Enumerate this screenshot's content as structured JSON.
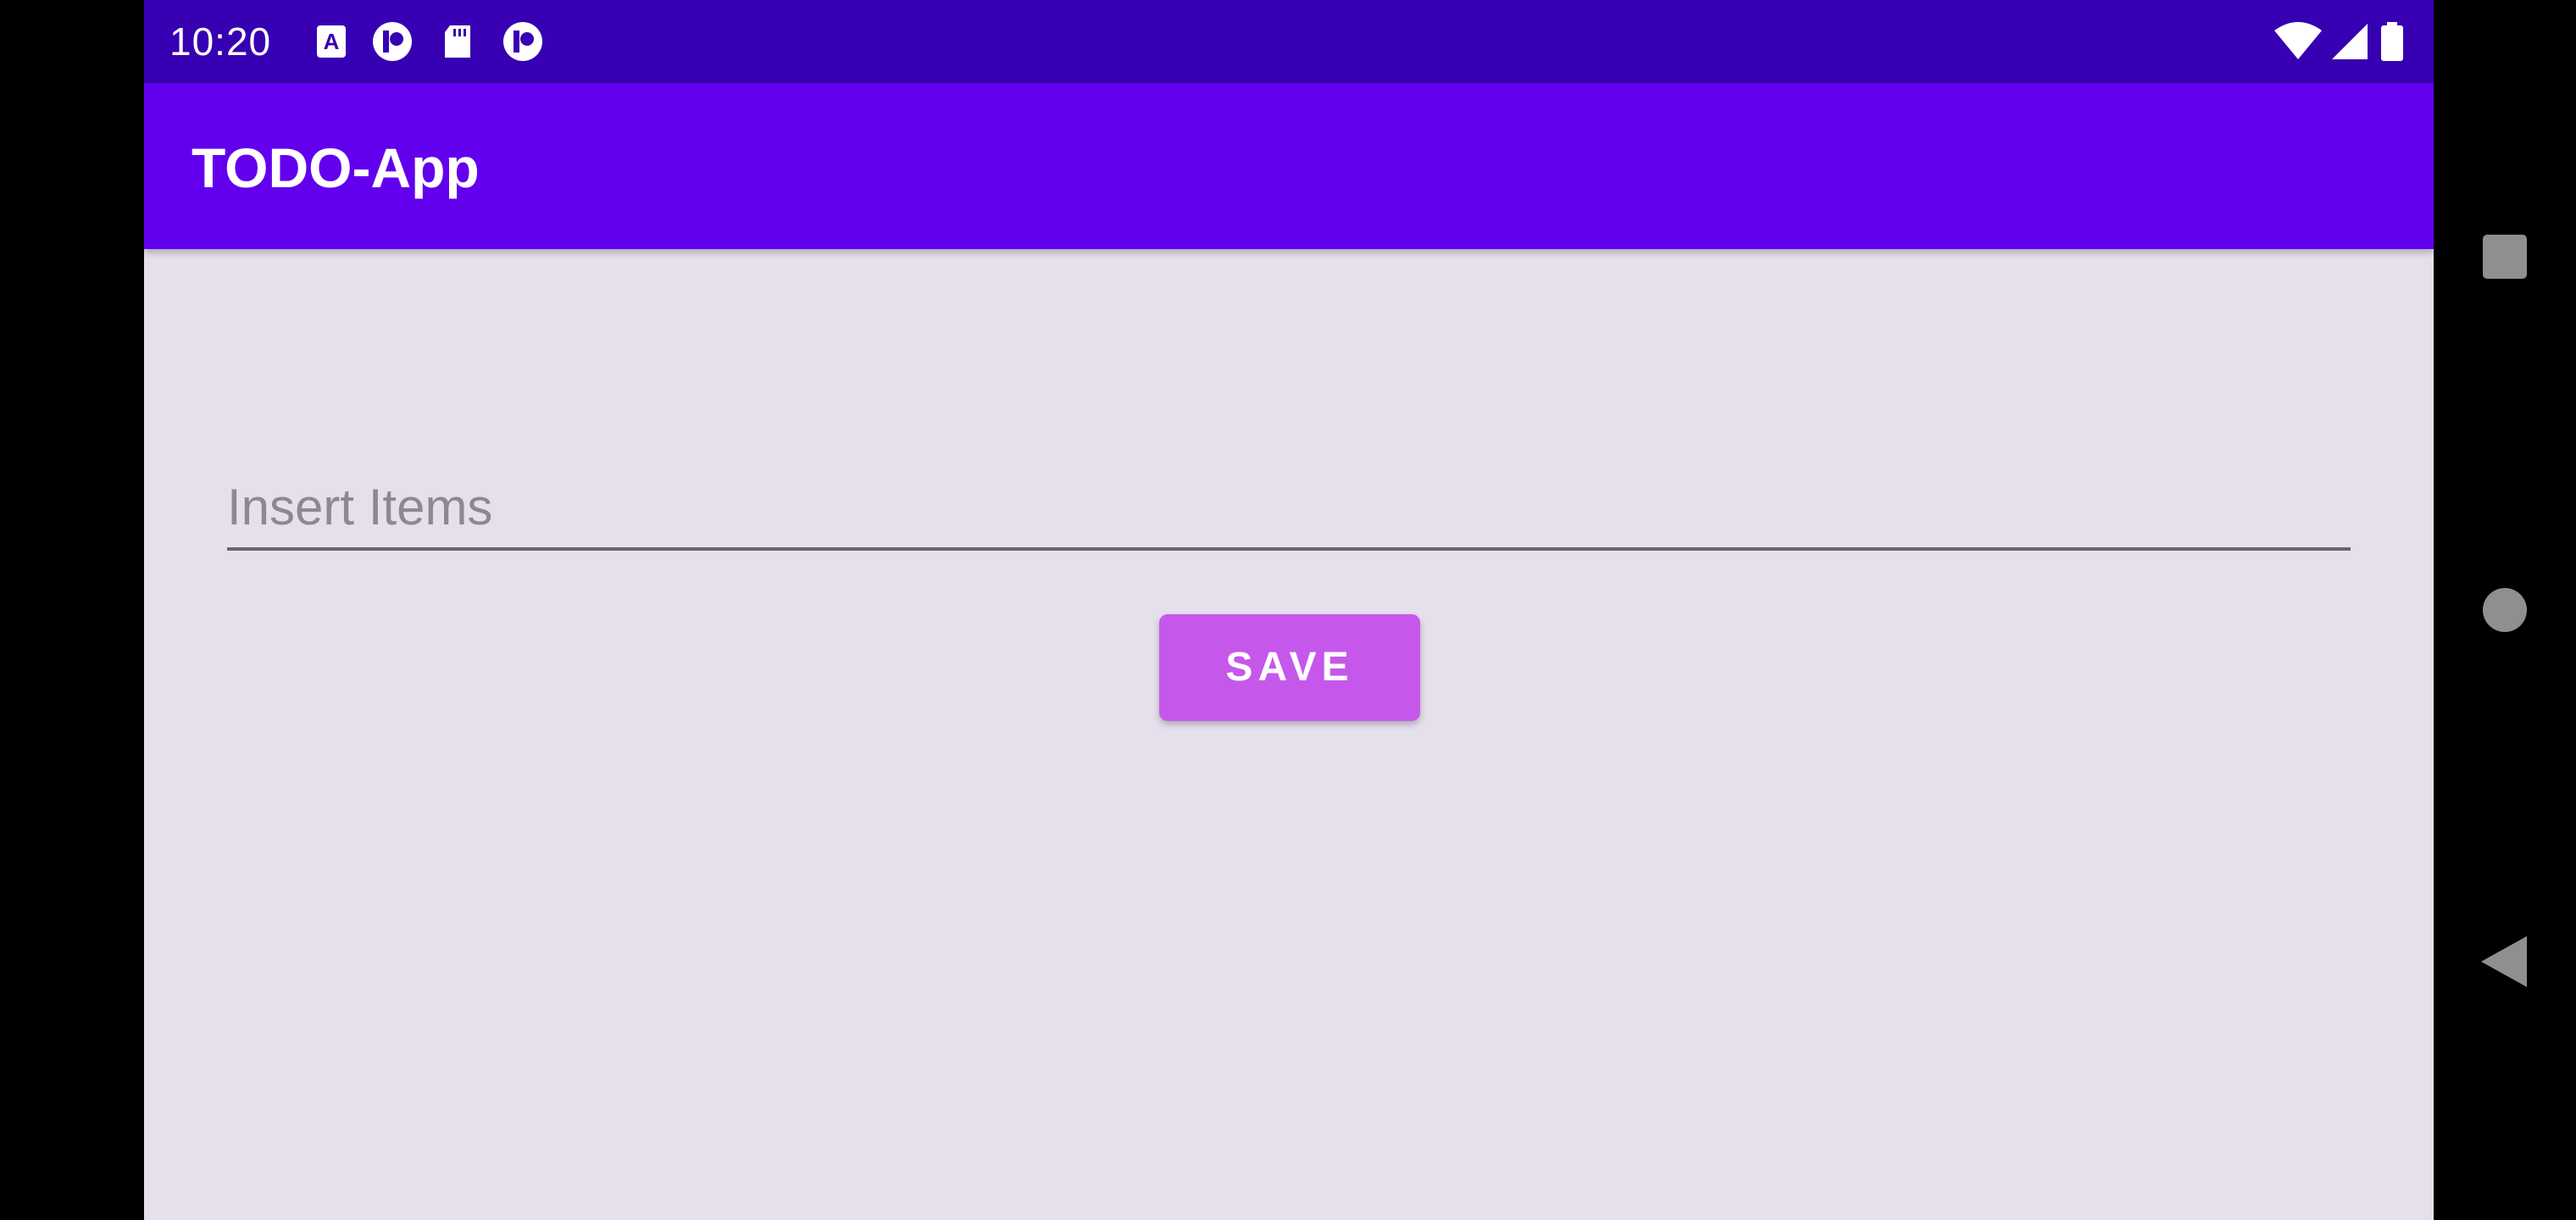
{
  "status_bar": {
    "time": "10:20",
    "left_icons": [
      "font-a-icon",
      "app-circle-icon",
      "sd-card-icon",
      "app-circle-icon"
    ],
    "right_icons": [
      "wifi-icon",
      "signal-icon",
      "battery-icon"
    ]
  },
  "app_bar": {
    "title": "TODO-App"
  },
  "form": {
    "input_value": "",
    "input_placeholder": "Insert Items",
    "save_label": "SAVE"
  },
  "nav_bar": {
    "buttons": [
      "recents-square-icon",
      "home-circle-icon",
      "back-triangle-icon"
    ]
  },
  "colors": {
    "status_bar": "#3700b3",
    "app_bar": "#6200ee",
    "background": "#e6e0ec",
    "save_button": "#c558eb",
    "placeholder": "#8d8893"
  }
}
